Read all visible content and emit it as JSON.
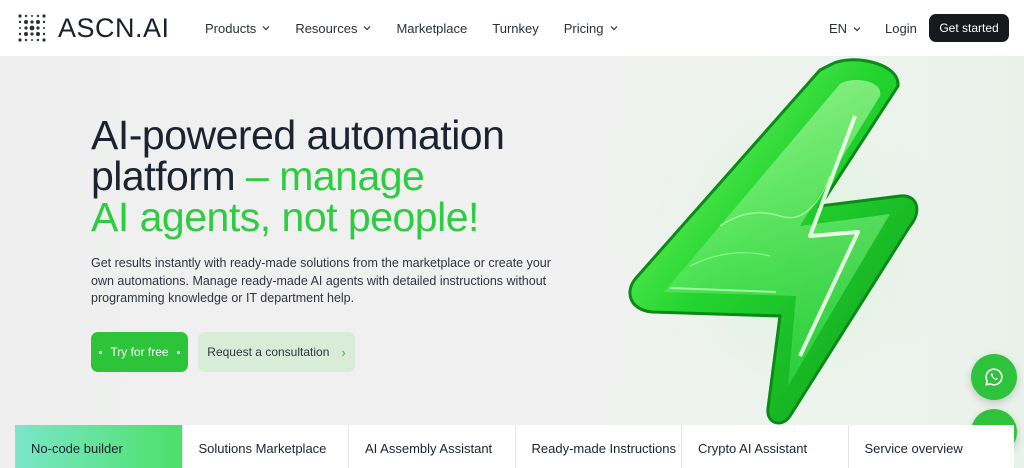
{
  "brand": {
    "name": "ASCN.AI"
  },
  "nav": {
    "items": [
      {
        "label": "Products",
        "has_dropdown": true
      },
      {
        "label": "Resources",
        "has_dropdown": true
      },
      {
        "label": "Marketplace",
        "has_dropdown": false
      },
      {
        "label": "Turnkey",
        "has_dropdown": false
      },
      {
        "label": "Pricing",
        "has_dropdown": true
      }
    ],
    "language": "EN",
    "login": "Login",
    "cta": "Get started"
  },
  "hero": {
    "headline_line1": "AI-powered automation",
    "headline_line2_dark": "platform",
    "headline_line2_green": " – manage",
    "headline_line3_green": "AI agents, not people!",
    "description": "Get results instantly with ready-made solutions from the marketplace or create your own automations. Manage ready-made AI agents with detailed instructions without programming knowledge or IT department help.",
    "primary_button": "Try for free",
    "secondary_button": "Request a consultation",
    "accent_color": "#2ecc40"
  },
  "tabs": [
    {
      "label": "No-code builder",
      "active": true
    },
    {
      "label": "Solutions Marketplace",
      "active": false
    },
    {
      "label": "AI Assembly Assistant",
      "active": false
    },
    {
      "label": "Ready-made Instructions",
      "active": false
    },
    {
      "label": "Crypto AI Assistant",
      "active": false
    },
    {
      "label": "Service overview",
      "active": false
    }
  ],
  "floating": {
    "whatsapp_icon": "whatsapp-icon",
    "telegram_icon": "telegram-icon"
  }
}
